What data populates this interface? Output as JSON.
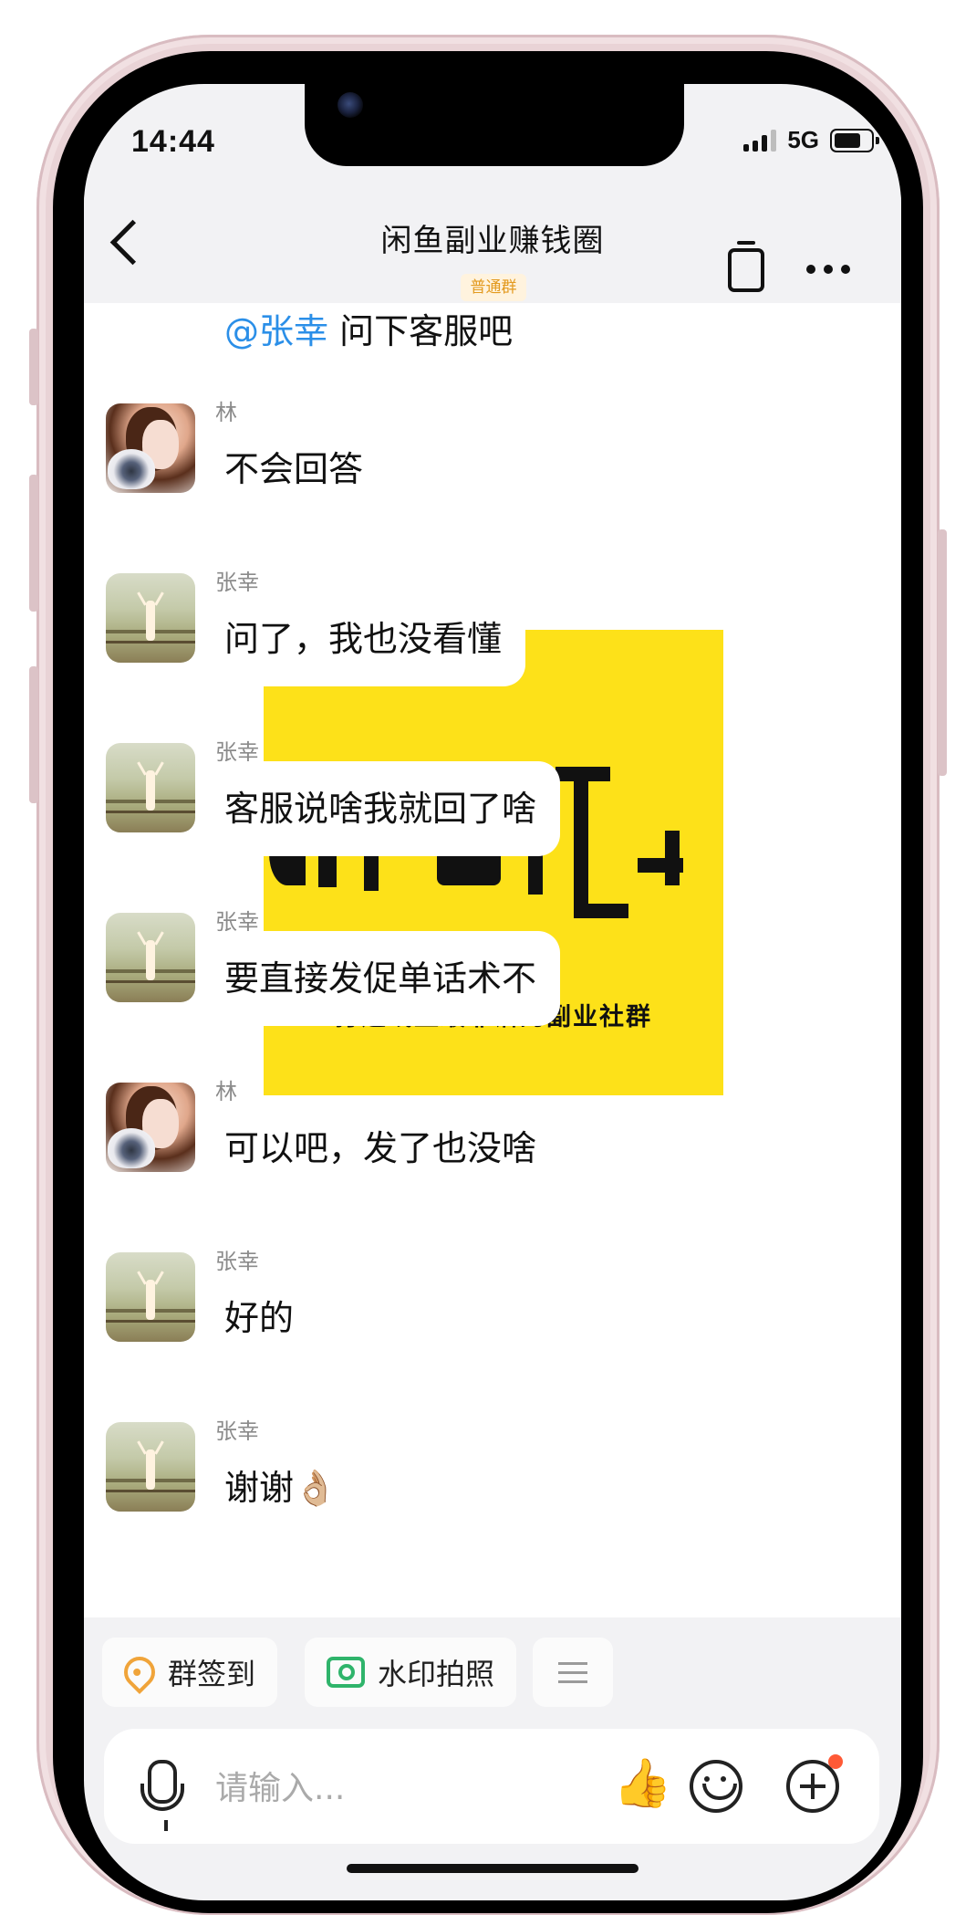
{
  "status_bar": {
    "time": "14:44",
    "network": "5G"
  },
  "header": {
    "title": "闲鱼副业赚钱圈",
    "badge": "普通群"
  },
  "messages": [
    {
      "sender": "",
      "mention": "@张幸",
      "text": " 问下客服吧"
    },
    {
      "sender": "林",
      "text": "不会回答"
    },
    {
      "sender": "张幸",
      "text": "问了，我也没看懂"
    },
    {
      "sender": "张幸",
      "text": "客服说啥我就回了啥"
    },
    {
      "sender": "张幸",
      "text": "要直接发促单话术不"
    },
    {
      "sender": "林",
      "text": "可以吧，发了也没啥"
    },
    {
      "sender": "张幸",
      "text": "好的"
    },
    {
      "sender": "张幸",
      "text": "谢谢👌🏼"
    }
  ],
  "poster": {
    "tagline": "打造线上最靠谱的副业社群",
    "color": "#fde119"
  },
  "quick_actions": [
    {
      "label": "群签到",
      "icon": "location-pin-icon"
    },
    {
      "label": "水印拍照",
      "icon": "camera-icon"
    }
  ],
  "input": {
    "placeholder": "请输入..."
  }
}
